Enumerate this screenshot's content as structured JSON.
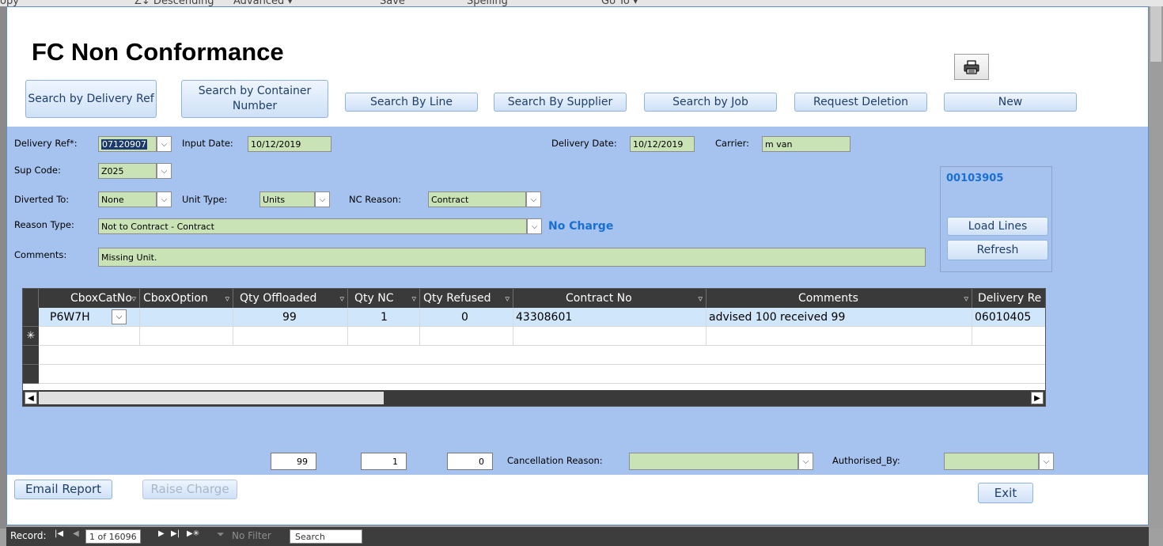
{
  "ribbon": {
    "items": [
      "opy",
      "Z↓ Descending",
      "Advanced ▾",
      "Save",
      "Spelling",
      "Go To ▾"
    ]
  },
  "form": {
    "title": "FC Non Conformance",
    "toolbar": {
      "search_delivery_ref": "Search by Delivery Ref",
      "search_container": "Search by Container Number",
      "search_line": "Search By Line",
      "search_supplier": "Search By Supplier",
      "search_job": "Search by Job",
      "request_deletion": "Request Deletion",
      "new": "New",
      "print_icon": "printer-icon"
    },
    "fields": {
      "delivery_ref_label": "Delivery Ref*:",
      "delivery_ref_value": "07120907",
      "input_date_label": "Input Date:",
      "input_date_value": "10/12/2019",
      "delivery_date_label": "Delivery Date:",
      "delivery_date_value": "10/12/2019",
      "carrier_label": "Carrier:",
      "carrier_value": "m van",
      "sup_code_label": "Sup Code:",
      "sup_code_value": "Z025",
      "diverted_to_label": "Diverted To:",
      "diverted_to_value": "None",
      "unit_type_label": "Unit Type:",
      "unit_type_value": "Units",
      "nc_reason_label": "NC Reason:",
      "nc_reason_value": "Contract",
      "reason_type_label": "Reason Type:",
      "reason_type_value": "Not to Contract - Contract",
      "charge_status": "No Charge",
      "comments_label": "Comments:",
      "comments_value": "Missing Unit."
    },
    "side_panel": {
      "id": "00103905",
      "load_lines": "Load Lines",
      "refresh": "Refresh"
    },
    "grid": {
      "columns": [
        "CboxCatNo",
        "CboxOption",
        "Qty Offloaded",
        "Qty NC",
        "Qty Refused",
        "Contract No",
        "Comments",
        "Delivery Re"
      ],
      "rows": [
        {
          "cat": "P6W7H",
          "option": "",
          "qty_offloaded": "99",
          "qty_nc": "1",
          "qty_refused": "0",
          "contract_no": "43308601",
          "comments": "advised 100 received 99",
          "delivery_ref": "06010405"
        }
      ],
      "new_row_marker": "✳"
    },
    "totals": {
      "offloaded": "99",
      "nc": "1",
      "refused": "0",
      "cancellation_label": "Cancellation Reason:",
      "authorised_label": "Authorised_By:"
    },
    "footer": {
      "email_report": "Email Report",
      "raise_charge": "Raise Charge",
      "exit": "Exit"
    }
  },
  "record_nav": {
    "label": "Record:",
    "position": "1 of 16096",
    "filter": "No Filter",
    "search": "Search"
  },
  "colors": {
    "detail_band": "#a6c3ef",
    "field_bg": "#c9e2b6",
    "accent_blue": "#1a6fd2",
    "grid_header": "#3a3a3a"
  }
}
